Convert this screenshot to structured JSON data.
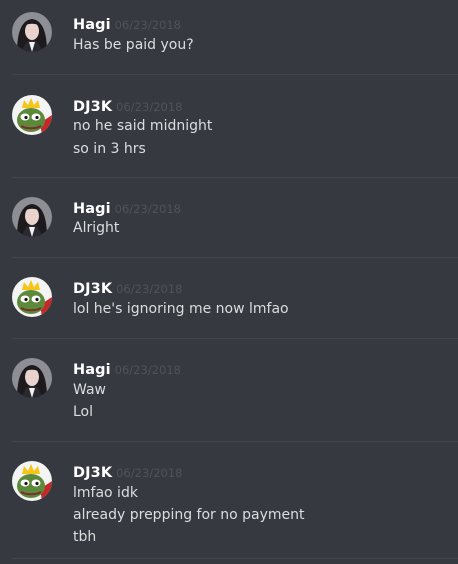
{
  "messages": [
    {
      "username": "Hagi",
      "timestamp": "06/23/2018",
      "avatar": "hagi-avatar",
      "lines": [
        "Has be paid you?"
      ]
    },
    {
      "username": "DJ3K",
      "timestamp": "06/23/2018",
      "avatar": "pepe-king-avatar",
      "lines": [
        "no he said midnight",
        "so in 3 hrs"
      ]
    },
    {
      "username": "Hagi",
      "timestamp": "06/23/2018",
      "avatar": "hagi-avatar",
      "lines": [
        "Alright"
      ]
    },
    {
      "username": "DJ3K",
      "timestamp": "06/23/2018",
      "avatar": "pepe-king-avatar",
      "lines": [
        "lol he's ignoring me now lmfao"
      ]
    },
    {
      "username": "Hagi",
      "timestamp": "06/23/2018",
      "avatar": "hagi-avatar",
      "lines": [
        "Waw",
        "Lol"
      ]
    },
    {
      "username": "DJ3K",
      "timestamp": "06/23/2018",
      "avatar": "pepe-king-avatar",
      "lines": [
        "lmfao idk",
        "already prepping for no payment",
        "tbh"
      ]
    }
  ],
  "colors": {
    "background": "#36393f",
    "username": "#ffffff",
    "timestamp": "#4f535a",
    "message_text": "#dcddde",
    "divider": "#42454a"
  }
}
